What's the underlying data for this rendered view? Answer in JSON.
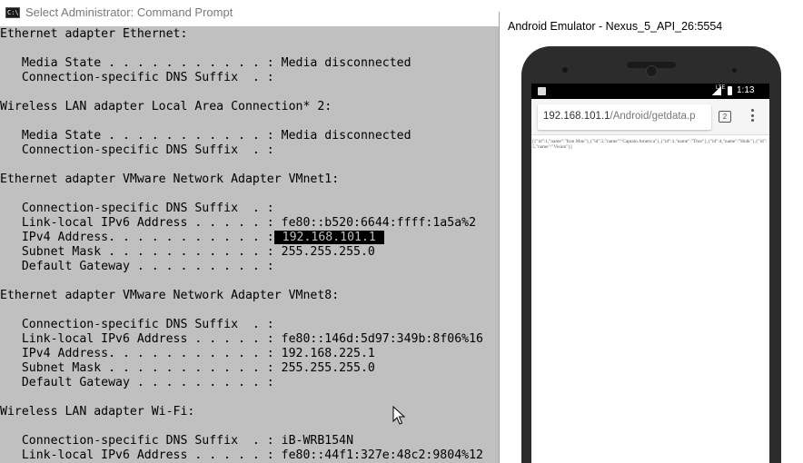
{
  "cmd": {
    "title": "Select Administrator: Command Prompt",
    "icon_label": "C:\\",
    "lines": [
      {
        "text": "Ethernet adapter Ethernet:"
      },
      {
        "text": ""
      },
      {
        "text": "   Media State . . . . . . . . . . . : Media disconnected"
      },
      {
        "text": "   Connection-specific DNS Suffix  . :"
      },
      {
        "text": ""
      },
      {
        "text": "Wireless LAN adapter Local Area Connection* 2:"
      },
      {
        "text": ""
      },
      {
        "text": "   Media State . . . . . . . . . . . : Media disconnected"
      },
      {
        "text": "   Connection-specific DNS Suffix  . :"
      },
      {
        "text": ""
      },
      {
        "text": "Ethernet adapter VMware Network Adapter VMnet1:"
      },
      {
        "text": ""
      },
      {
        "text": "   Connection-specific DNS Suffix  . :"
      },
      {
        "text": "   Link-local IPv6 Address . . . . . : fe80::b520:6644:ffff:1a5a%2"
      },
      {
        "text": "   IPv4 Address. . . . . . . . . . . :",
        "selected": " 192.168.101.1 "
      },
      {
        "text": "   Subnet Mask . . . . . . . . . . . : 255.255.255.0"
      },
      {
        "text": "   Default Gateway . . . . . . . . . :"
      },
      {
        "text": ""
      },
      {
        "text": "Ethernet adapter VMware Network Adapter VMnet8:"
      },
      {
        "text": ""
      },
      {
        "text": "   Connection-specific DNS Suffix  . :"
      },
      {
        "text": "   Link-local IPv6 Address . . . . . : fe80::146d:5d97:349b:8f06%16"
      },
      {
        "text": "   IPv4 Address. . . . . . . . . . . : 192.168.225.1"
      },
      {
        "text": "   Subnet Mask . . . . . . . . . . . : 255.255.255.0"
      },
      {
        "text": "   Default Gateway . . . . . . . . . :"
      },
      {
        "text": ""
      },
      {
        "text": "Wireless LAN adapter Wi-Fi:"
      },
      {
        "text": ""
      },
      {
        "text": "   Connection-specific DNS Suffix  . : iB-WRB154N"
      },
      {
        "text": "   Link-local IPv6 Address . . . . . : fe80::44f1:327e:48c2:9804%12"
      }
    ]
  },
  "emulator": {
    "title": "Android Emulator - Nexus_5_API_26:5554",
    "status_bar": {
      "network": "LTE",
      "time": "1:13"
    },
    "browser": {
      "url_host": "192.168.101.1",
      "url_path": "/Android/getdata.p",
      "tab_count": "2",
      "content": "[{\"id\":1,\"name\":\"Iron Man\"},{\"id\":2,\"name\":\"Captain America\"},{\"id\":3,\"name\":\"Thor\"},{\"id\":4,\"name\":\"Hulk\"},{\"id\":5,\"name\":\"Vision\"}]"
    }
  },
  "colors": {
    "console_background": "#c0c0c0",
    "console_text": "#000000",
    "selection_background": "#000000",
    "selection_text": "#c0c0c0"
  }
}
